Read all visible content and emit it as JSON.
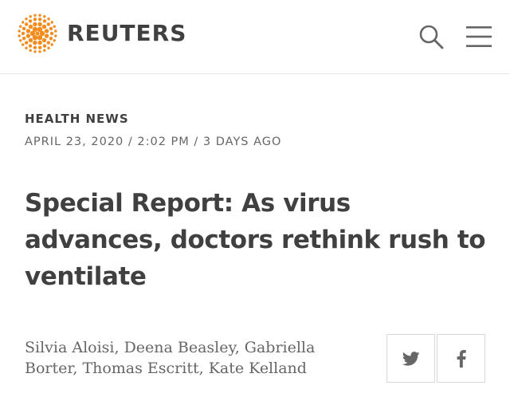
{
  "header": {
    "logo_text": "REUTERS",
    "logo_icon": "reuters-dot-logo",
    "search_icon": "search-icon",
    "menu_icon": "hamburger-menu-icon"
  },
  "article": {
    "section": "HEALTH NEWS",
    "dateline": "APRIL 23, 2020 / 2:02 PM / 3 DAYS AGO",
    "headline": "Special Report: As virus advances, doctors rethink rush to ventilate",
    "byline": "Silvia Aloisi, Deena Beasley, Gabriella Borter, Thomas Escritt, Kate Kelland"
  },
  "share": {
    "twitter_icon": "twitter-icon",
    "facebook_icon": "facebook-icon"
  },
  "colors": {
    "brand_orange": "#f28c1f",
    "text_dark": "#404040",
    "text_muted": "#666666"
  }
}
